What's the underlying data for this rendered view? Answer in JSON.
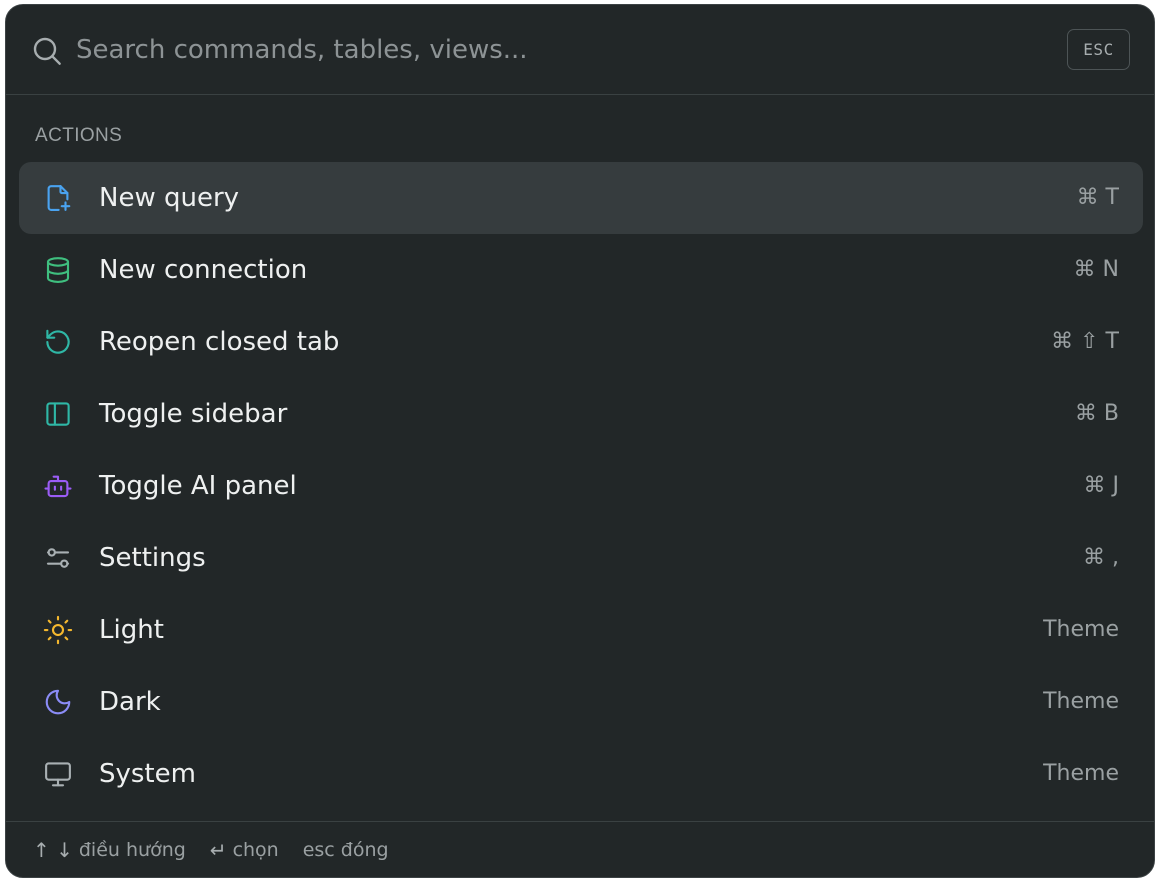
{
  "search": {
    "placeholder": "Search commands, tables, views...",
    "value": "",
    "esc_label": "ESC"
  },
  "section": {
    "heading": "ACTIONS"
  },
  "items": [
    {
      "label": "New query",
      "hint": "⌘ T",
      "icon": "file-plus-icon",
      "color": "#4aa3f0",
      "selected": true
    },
    {
      "label": "New connection",
      "hint": "⌘ N",
      "icon": "database-icon",
      "color": "#3fbf7f"
    },
    {
      "label": "Reopen closed tab",
      "hint": "⌘ ⇧ T",
      "icon": "rotate-ccw-icon",
      "color": "#2fb7a6"
    },
    {
      "label": "Toggle sidebar",
      "hint": "⌘ B",
      "icon": "sidebar-icon",
      "color": "#2fb7a6"
    },
    {
      "label": "Toggle AI panel",
      "hint": "⌘ J",
      "icon": "bot-icon",
      "color": "#9b5cf6"
    },
    {
      "label": "Settings",
      "hint": "⌘ ,",
      "icon": "sliders-icon",
      "color": "#a9b0b3"
    },
    {
      "label": "Light",
      "hint": "Theme",
      "icon": "sun-icon",
      "color": "#f5b82e"
    },
    {
      "label": "Dark",
      "hint": "Theme",
      "icon": "moon-icon",
      "color": "#8b8cf6"
    },
    {
      "label": "System",
      "hint": "Theme",
      "icon": "monitor-icon",
      "color": "#a9b0b3"
    }
  ],
  "footer": {
    "navigate_keys": "↑ ↓",
    "navigate_label": "điều hướng",
    "select_key": "↵",
    "select_label": "chọn",
    "close_key": "esc",
    "close_label": "đóng"
  }
}
